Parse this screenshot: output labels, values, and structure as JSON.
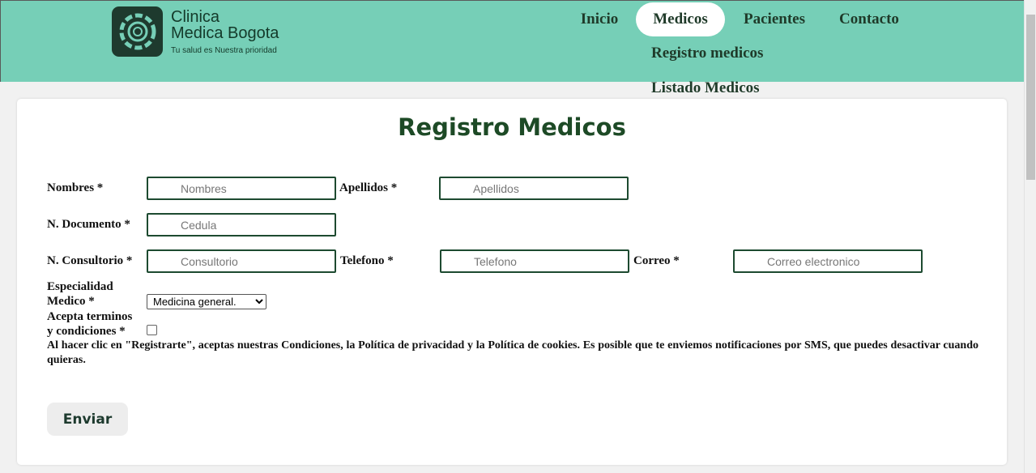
{
  "brand": {
    "name_line1": "Clinica",
    "name_line2": "Medica Bogota",
    "tagline": "Tu salud es Nuestra prioridad",
    "color_primary": "#76cfb7",
    "color_dark": "#1e3a2e"
  },
  "nav": {
    "items": [
      {
        "label": "Inicio"
      },
      {
        "label": "Medicos",
        "active": true
      },
      {
        "label": "Pacientes"
      },
      {
        "label": "Contacto"
      }
    ],
    "submenu": [
      {
        "label": "Registro medicos"
      },
      {
        "label": "Listado Medicos"
      }
    ]
  },
  "form": {
    "title": "Registro Medicos",
    "fields": {
      "nombres": {
        "label": "Nombres *",
        "placeholder": "Nombres",
        "value": ""
      },
      "apellidos": {
        "label": "Apellidos *",
        "placeholder": "Apellidos",
        "value": ""
      },
      "documento": {
        "label": "N. Documento *",
        "placeholder": "Cedula",
        "value": ""
      },
      "consultorio": {
        "label": "N. Consultorio *",
        "placeholder": "Consultorio",
        "value": ""
      },
      "telefono": {
        "label": "Telefono *",
        "placeholder": "Telefono",
        "value": ""
      },
      "correo": {
        "label": "Correo *",
        "placeholder": "Correo electronico",
        "value": ""
      },
      "especialidad": {
        "label_line1": "Especialidad",
        "label_line2": "Medico *",
        "selected": "Medicina general."
      },
      "terminos": {
        "label_line1": "Acepta terminos",
        "label_line2": "y condiciones *",
        "checked": false
      }
    },
    "legal_text": "Al hacer clic en \"Registrarte\", aceptas nuestras Condiciones, la Política de privacidad y la Política de cookies. Es posible que te enviemos notificaciones por SMS, que puedes desactivar cuando quieras.",
    "submit_label": "Enviar",
    "accent_color": "#1d4a26"
  }
}
